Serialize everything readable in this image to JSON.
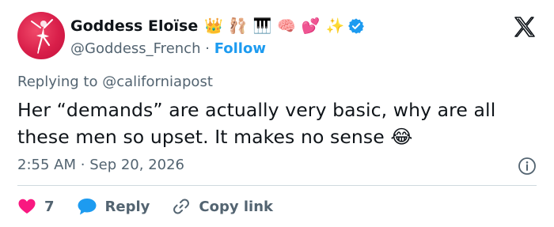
{
  "user": {
    "display_name": "Goddess Eloïse",
    "name_emojis": [
      "👑",
      "🩰",
      "🎹",
      "🧠",
      "💕",
      "✨"
    ],
    "handle": "@Goddess_French",
    "separator": "·",
    "follow_label": "Follow",
    "verified_color": "#1d9bf0"
  },
  "reply_context": {
    "text": "Replying to @californiapost"
  },
  "tweet": {
    "line1": "Her “demands” are actually very basic, why are all",
    "line2": "these men so upset. It makes no sense",
    "emoji": "😂"
  },
  "meta": {
    "time": "2:55 AM",
    "separator": "·",
    "date": "Sep 20, 2026"
  },
  "actions": {
    "like_count": "7",
    "reply_label": "Reply",
    "copy_link_label": "Copy link"
  },
  "colors": {
    "like": "#f91880",
    "reply": "#1d9bf0",
    "link": "#1d9bf0",
    "muted": "#536471",
    "text": "#0f1419"
  },
  "icons": {
    "logo": "x-logo-icon",
    "info": "info-icon",
    "like": "heart-icon",
    "reply": "speech-bubble-icon",
    "copy": "link-icon"
  }
}
